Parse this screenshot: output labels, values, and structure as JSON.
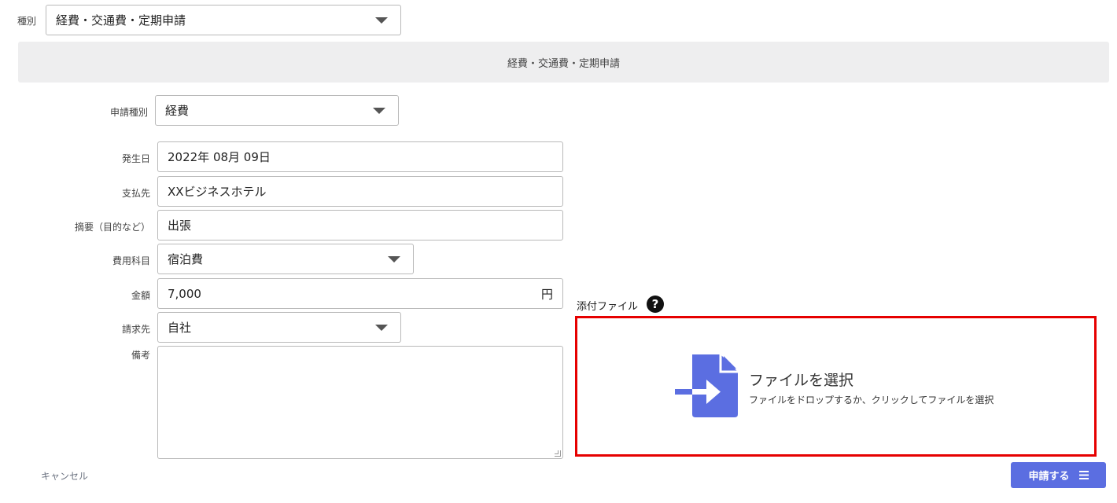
{
  "category": {
    "label": "種別",
    "selected": "経費・交通費・定期申請"
  },
  "section_header": "経費・交通費・定期申請",
  "form": {
    "application_type": {
      "label": "申請種別",
      "selected": "経費"
    },
    "date": {
      "label": "発生日",
      "value": "2022年 08月 09日"
    },
    "payee": {
      "label": "支払先",
      "value": "XXビジネスホテル"
    },
    "summary": {
      "label": "摘要（目的など）",
      "value": "出張"
    },
    "expense_item": {
      "label": "費用科目",
      "selected": "宿泊費"
    },
    "amount": {
      "label": "金額",
      "value": "7,000",
      "unit": "円"
    },
    "bill_to": {
      "label": "請求先",
      "selected": "自社"
    },
    "notes": {
      "label": "備考",
      "value": ""
    }
  },
  "attachment": {
    "label": "添付ファイル",
    "help_glyph": "?",
    "title": "ファイルを選択",
    "subtitle": "ファイルをドロップするか、クリックしてファイルを選択",
    "accent_color": "#5b6ee1",
    "highlight_color": "#e60000"
  },
  "actions": {
    "cancel_label": "キャンセル",
    "submit_label": "申請する",
    "submit_icon": "menu-icon"
  }
}
